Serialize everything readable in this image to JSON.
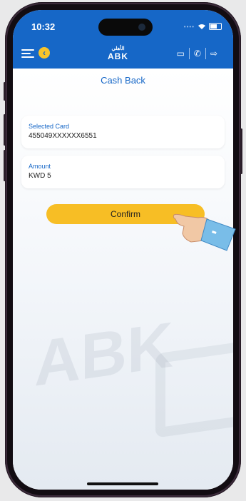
{
  "status_bar": {
    "time": "10:32"
  },
  "header": {
    "logo_text": "ABK"
  },
  "page": {
    "title": "Cash Back"
  },
  "fields": [
    {
      "label": "Selected Card",
      "value": "455049XXXXXX6551"
    },
    {
      "label": "Amount",
      "value": "KWD 5"
    }
  ],
  "actions": {
    "confirm_label": "Confirm"
  },
  "colors": {
    "primary": "#1667c7",
    "accent": "#f7be25"
  }
}
